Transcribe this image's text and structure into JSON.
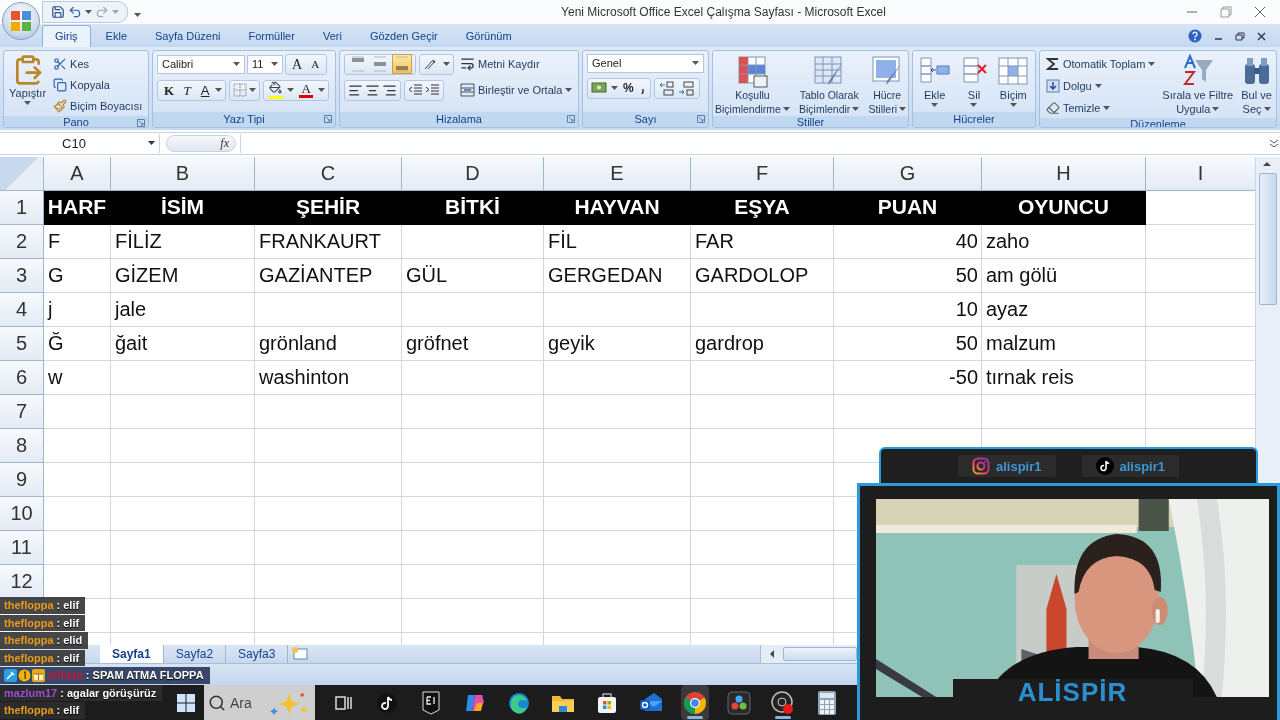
{
  "window": {
    "title": "Yeni Microsoft Office Excel Çalışma Sayfası - Microsoft Excel"
  },
  "ribbon_tabs": [
    {
      "label": "Giriş",
      "selected": true
    },
    {
      "label": "Ekle",
      "selected": false
    },
    {
      "label": "Sayfa Düzeni",
      "selected": false
    },
    {
      "label": "Formüller",
      "selected": false
    },
    {
      "label": "Veri",
      "selected": false
    },
    {
      "label": "Gözden Geçir",
      "selected": false
    },
    {
      "label": "Görünüm",
      "selected": false
    }
  ],
  "clipboard": {
    "label": "Pano",
    "paste": "Yapıştır",
    "commands": [
      "Kes",
      "Kopyala",
      "Biçim Boyacısı"
    ]
  },
  "font": {
    "label": "Yazı Tipi",
    "font_name": "Calibri",
    "font_size": "11",
    "grow": "A",
    "shrink": "A",
    "bold": "K",
    "italic": "T",
    "underline": "A",
    "font_color": "A"
  },
  "alignment": {
    "label": "Hizalama",
    "vertical": [
      {
        "selected": false
      },
      {
        "selected": false
      },
      {
        "selected": true
      }
    ],
    "wrap": "Metni Kaydır",
    "merge": "Birleştir ve Ortala"
  },
  "number": {
    "label": "Sayı",
    "format": "Genel",
    "percent": "%"
  },
  "styles": {
    "label": "Stiller",
    "commands": [
      {
        "lines": [
          "Koşullu",
          "Biçimlendirme"
        ]
      },
      {
        "lines": [
          "Tablo Olarak",
          "Biçimlendir"
        ]
      },
      {
        "lines": [
          "Hücre",
          "Stilleri"
        ]
      }
    ]
  },
  "cells": {
    "label": "Hücreler",
    "commands": [
      "Ekle",
      "Sil",
      "Biçim"
    ]
  },
  "editing": {
    "label": "Düzenleme",
    "commands": [
      "Otomatik Toplam",
      "Dolgu",
      "Temizle"
    ],
    "large": [
      {
        "lines": [
          "Sırala ve Filtre",
          "Uygula"
        ]
      },
      {
        "lines": [
          "Bul ve",
          "Seç"
        ]
      }
    ]
  },
  "formula_bar": {
    "name_box": "C10",
    "function_label": "fx"
  },
  "sheet": {
    "columns": [
      {
        "label": "A"
      },
      {
        "label": "B"
      },
      {
        "label": "C"
      },
      {
        "label": "D"
      },
      {
        "label": "E"
      },
      {
        "label": "F"
      },
      {
        "label": "G",
        "numeric": true
      },
      {
        "label": "H"
      },
      {
        "label": "I"
      }
    ],
    "rows": [
      {
        "number": "1",
        "kind": "header",
        "cells": [
          "HARF",
          "İSİM",
          "ŞEHİR",
          "BİTKİ",
          "HAYVAN",
          "EŞYA",
          "PUAN",
          "OYUNCU"
        ]
      },
      {
        "number": "2",
        "kind": "data",
        "cells": [
          "F",
          "FİLİZ",
          "FRANKAURT",
          null,
          "FİL",
          "FAR",
          "40",
          "zaho"
        ]
      },
      {
        "number": "3",
        "kind": "data",
        "cells": [
          "G",
          "GİZEM",
          "GAZİANTEP",
          "GÜL",
          "GERGEDAN",
          "GARDOLOP",
          "50",
          "am gölü"
        ]
      },
      {
        "number": "4",
        "kind": "data",
        "cells": [
          "j",
          "jale",
          null,
          null,
          null,
          null,
          "10",
          "ayaz"
        ]
      },
      {
        "number": "5",
        "kind": "data",
        "cells": [
          "Ğ",
          "ğait",
          "grönland",
          "gröfnet",
          "geyik",
          "gardrop",
          "50",
          "malzum"
        ]
      },
      {
        "number": "6",
        "kind": "data",
        "cells": [
          "w",
          null,
          "washinton",
          null,
          null,
          null,
          "-50",
          "tırnak reis"
        ]
      },
      {
        "number": "7",
        "kind": "data"
      },
      {
        "number": "8",
        "kind": "data"
      },
      {
        "number": "9",
        "kind": "data"
      },
      {
        "number": "10",
        "kind": "data"
      },
      {
        "number": "11",
        "kind": "data"
      },
      {
        "number": "12",
        "kind": "data"
      }
    ]
  },
  "sheet_tabs": [
    {
      "label": "Sayfa1",
      "selected": true
    },
    {
      "label": "Sayfa2",
      "selected": false
    },
    {
      "label": "Sayfa3",
      "selected": false
    }
  ],
  "chat": [
    {
      "kind": "plain",
      "user": "thefloppa",
      "color": "#e89a1c",
      "message": ": elif"
    },
    {
      "kind": "plain",
      "user": "thefloppa",
      "color": "#e89a1c",
      "message": ": elif"
    },
    {
      "kind": "plain",
      "user": "thefloppa",
      "color": "#e89a1c",
      "message": ": elid"
    },
    {
      "kind": "plain",
      "user": "thefloppa",
      "color": "#e89a1c",
      "message": ": elif"
    },
    {
      "kind": "badged",
      "user": "elifdsk",
      "color": "#c8143c",
      "message": ": SPAM ATMA FLOPPA"
    },
    {
      "kind": "plain",
      "user": "mazlum17",
      "color": "#9b4fd6",
      "message": ": agalar görüşürüz"
    },
    {
      "kind": "plain",
      "user": "thefloppa",
      "color": "#e89a1c",
      "message": ": elif"
    }
  ],
  "taskbar": {
    "search": {
      "placeholder": "Ara"
    },
    "apps": [
      {
        "selected": false,
        "running": false
      },
      {
        "selected": false,
        "running": false
      },
      {
        "selected": false,
        "running": false
      },
      {
        "selected": false,
        "running": false
      },
      {
        "selected": false,
        "running": false
      },
      {
        "selected": false,
        "running": false
      },
      {
        "selected": false,
        "running": false
      },
      {
        "selected": false,
        "running": false
      },
      {
        "selected": true,
        "running": true
      },
      {
        "selected": false,
        "running": false
      },
      {
        "selected": false,
        "running": true
      },
      {
        "selected": false,
        "running": false
      }
    ]
  },
  "stream_overlay": {
    "socials": [
      {
        "kind": "instagram",
        "handle": "alispir1"
      },
      {
        "kind": "tiktok",
        "handle": "alispir1"
      }
    ],
    "name": "ALİSPİR"
  }
}
